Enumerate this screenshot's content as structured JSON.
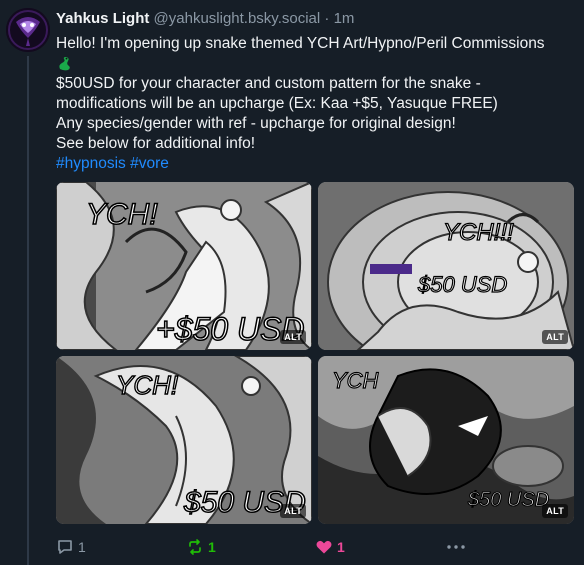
{
  "post": {
    "display_name": "Yahkus Light",
    "handle": "@yahkuslight.bsky.social",
    "separator": "·",
    "time": "1m",
    "lines": [
      "Hello! I'm opening up snake themed YCH Art/Hypno/Peril Commissions",
      "$50USD for your character and custom pattern for the snake -",
      "modifications will be an upcharge (Ex: Kaa +$5, Yasuque FREE)",
      "Any species/gender with ref - upcharge for original design!",
      "See below for additional info!"
    ],
    "emoji_icon": "snake-emoji-icon",
    "hashtags": [
      "#hypnosis",
      "#vore"
    ]
  },
  "images": [
    {
      "alt_badge": "ALT",
      "text": "YCH!",
      "price": "+$50 USD"
    },
    {
      "alt_badge": "ALT",
      "text": "YCH!!!",
      "price": "$50 USD"
    },
    {
      "alt_badge": "ALT",
      "text": "YCH!",
      "price": "$50 USD"
    },
    {
      "alt_badge": "ALT",
      "text": "YCH",
      "price": "$50 USD"
    }
  ],
  "actions": {
    "reply_count": "1",
    "repost_count": "1",
    "like_count": "1",
    "more_icon": "ellipsis-icon"
  },
  "colors": {
    "background": "#161e27",
    "text": "#f1f3f5",
    "muted": "#8b98a5",
    "link": "#208bfe",
    "repost_active": "#20bc07",
    "like_active": "#ec4899"
  }
}
